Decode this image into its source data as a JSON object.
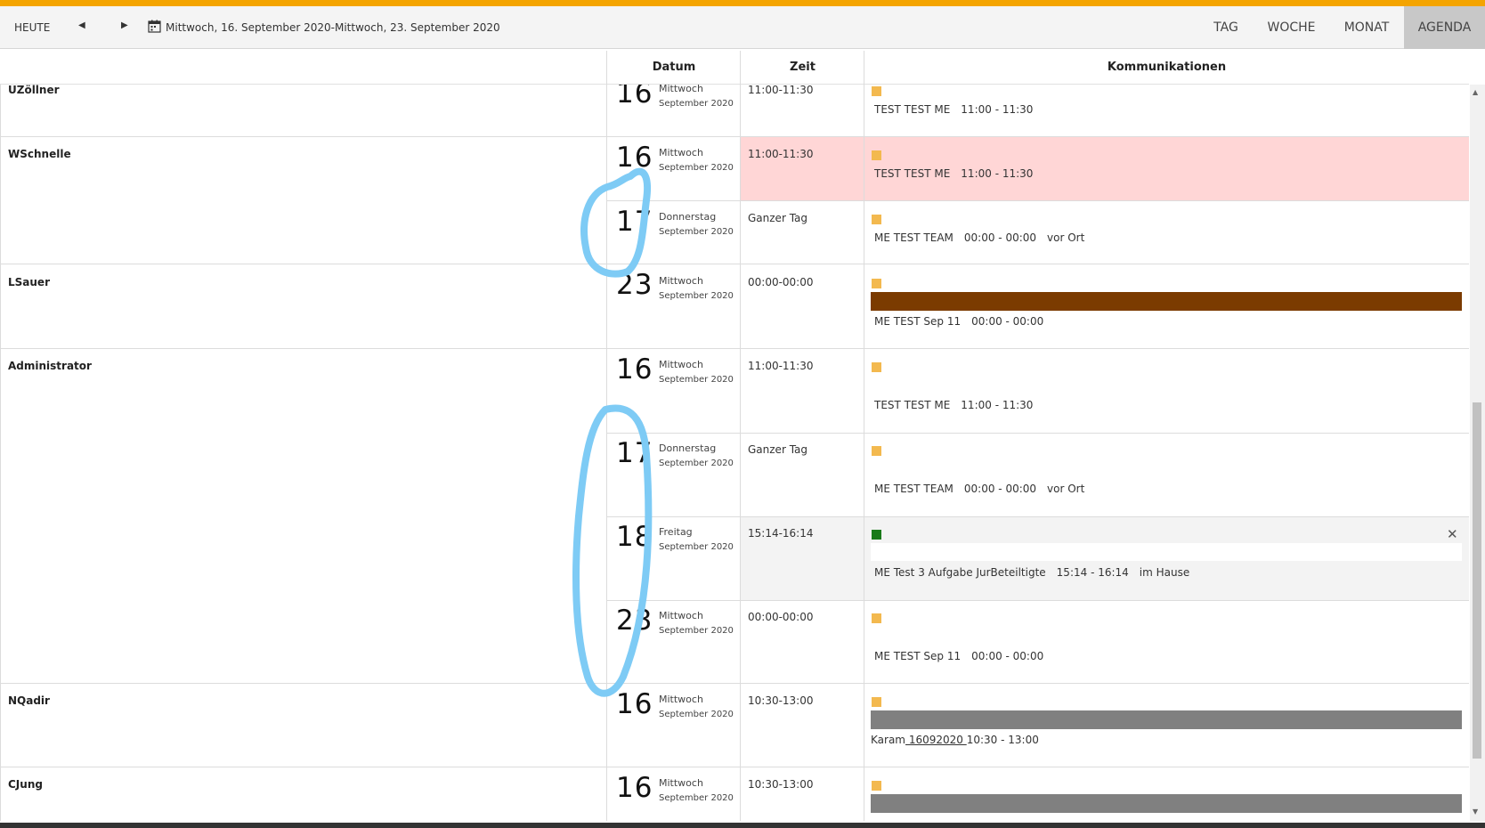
{
  "toolbar": {
    "today": "HEUTE",
    "date_range": "Mittwoch, 16. September 2020-Mittwoch, 23. September 2020",
    "views": [
      "TAG",
      "WOCHE",
      "MONAT",
      "AGENDA"
    ],
    "active_view": "AGENDA"
  },
  "columns": {
    "datum": "Datum",
    "zeit": "Zeit",
    "kommunikationen": "Kommunikationen"
  },
  "users": [
    "UZöllner",
    "WSchnelle",
    "LSauer",
    "Administrator",
    "NQadir",
    "CJung"
  ],
  "entries": [
    {
      "day": "16",
      "weekday": "Mittwoch",
      "month_year": "September 2020",
      "time": "11:00-11:30",
      "title": "TEST TEST ME",
      "event_time": "11:00 - 11:30",
      "location": ""
    },
    {
      "day": "16",
      "weekday": "Mittwoch",
      "month_year": "September 2020",
      "time": "11:00-11:30",
      "title": "TEST TEST ME",
      "event_time": "11:00 - 11:30",
      "location": ""
    },
    {
      "day": "17",
      "weekday": "Donnerstag",
      "month_year": "September 2020",
      "time": "Ganzer Tag",
      "title": "ME TEST TEAM",
      "event_time": "00:00 - 00:00",
      "location": "vor Ort"
    },
    {
      "day": "23",
      "weekday": "Mittwoch",
      "month_year": "September 2020",
      "time": "00:00-00:00",
      "title": "ME TEST Sep 11",
      "event_time": "00:00 - 00:00",
      "location": ""
    },
    {
      "day": "16",
      "weekday": "Mittwoch",
      "month_year": "September 2020",
      "time": "11:00-11:30",
      "title": "TEST TEST ME",
      "event_time": "11:00 - 11:30",
      "location": ""
    },
    {
      "day": "17",
      "weekday": "Donnerstag",
      "month_year": "September 2020",
      "time": "Ganzer Tag",
      "title": "ME TEST TEAM",
      "event_time": "00:00 - 00:00",
      "location": "vor Ort"
    },
    {
      "day": "18",
      "weekday": "Freitag",
      "month_year": "September 2020",
      "time": "15:14-16:14",
      "title": "ME Test 3 Aufgabe JurBeteiltigte",
      "event_time": "15:14 - 16:14",
      "location": "im Hause"
    },
    {
      "day": "23",
      "weekday": "Mittwoch",
      "month_year": "September 2020",
      "time": "00:00-00:00",
      "title": "ME TEST Sep 11",
      "event_time": "00:00 - 00:00",
      "location": ""
    },
    {
      "day": "16",
      "weekday": "Mittwoch",
      "month_year": "September 2020",
      "time": "10:30-13:00",
      "title": "Karam",
      "title_link": " 16092020 ",
      "event_time": "10:30 - 13:00",
      "location": ""
    },
    {
      "day": "16",
      "weekday": "Mittwoch",
      "month_year": "September 2020",
      "time": "10:30-13:00",
      "title": "",
      "event_time": "",
      "location": ""
    }
  ],
  "colors": {
    "accent": "#f4a400",
    "highlight_row": "#ffd6d6",
    "selected_row": "#f3f3f3",
    "marker_default": "#f3b94f",
    "marker_selected": "#1a7a1a",
    "bar_brown": "#7b3b00",
    "bar_gray": "#808080",
    "annotation": "#7ecbf5"
  },
  "icons": {
    "prev": "caret-left-icon",
    "next": "caret-right-icon",
    "calendar": "calendar-icon",
    "close": "close-icon"
  }
}
